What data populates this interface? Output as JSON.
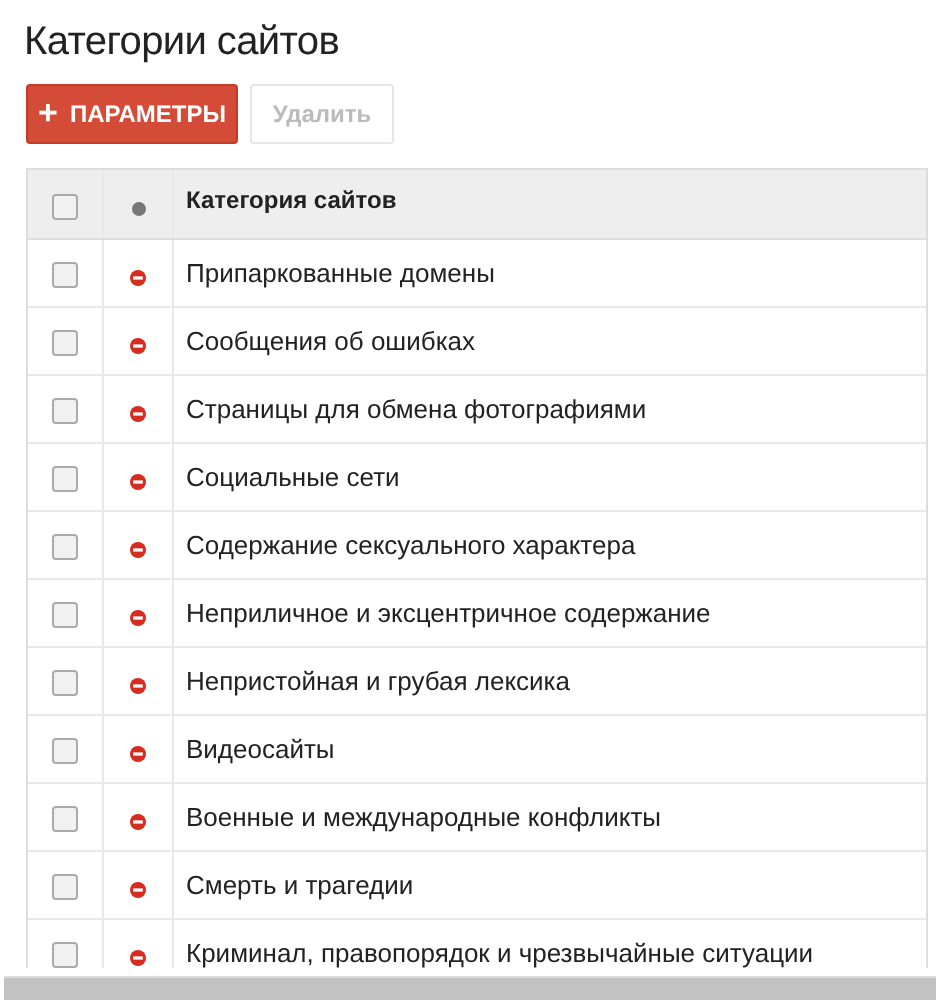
{
  "title": "Категории сайтов",
  "buttons": [
    {
      "kind": "primary",
      "icon": "+",
      "label": "ПАРАМЕТРЫ",
      "disabled": false
    },
    {
      "kind": "secondary",
      "label": "Удалить",
      "disabled": true
    }
  ],
  "table": {
    "header": {
      "checked": false,
      "label": "Категория сайтов"
    },
    "rows": [
      {
        "label": "Припаркованные домены",
        "checked": false
      },
      {
        "label": "Сообщения об ошибках",
        "checked": false
      },
      {
        "label": "Страницы для обмена фотографиями",
        "checked": false
      },
      {
        "label": "Социальные сети",
        "checked": false
      },
      {
        "label": "Содержание сексуального характера",
        "checked": false
      },
      {
        "label": "Неприличное и эксцентричное содержание",
        "checked": false
      },
      {
        "label": "Непристойная и грубая лексика",
        "checked": false
      },
      {
        "label": "Видеосайты",
        "checked": false
      },
      {
        "label": "Военные и международные конфликты",
        "checked": false
      },
      {
        "label": "Смерть и трагедии",
        "checked": false
      },
      {
        "label": "Криминал, правопорядок и чрезвычайные ситуации",
        "checked": false
      }
    ]
  }
}
